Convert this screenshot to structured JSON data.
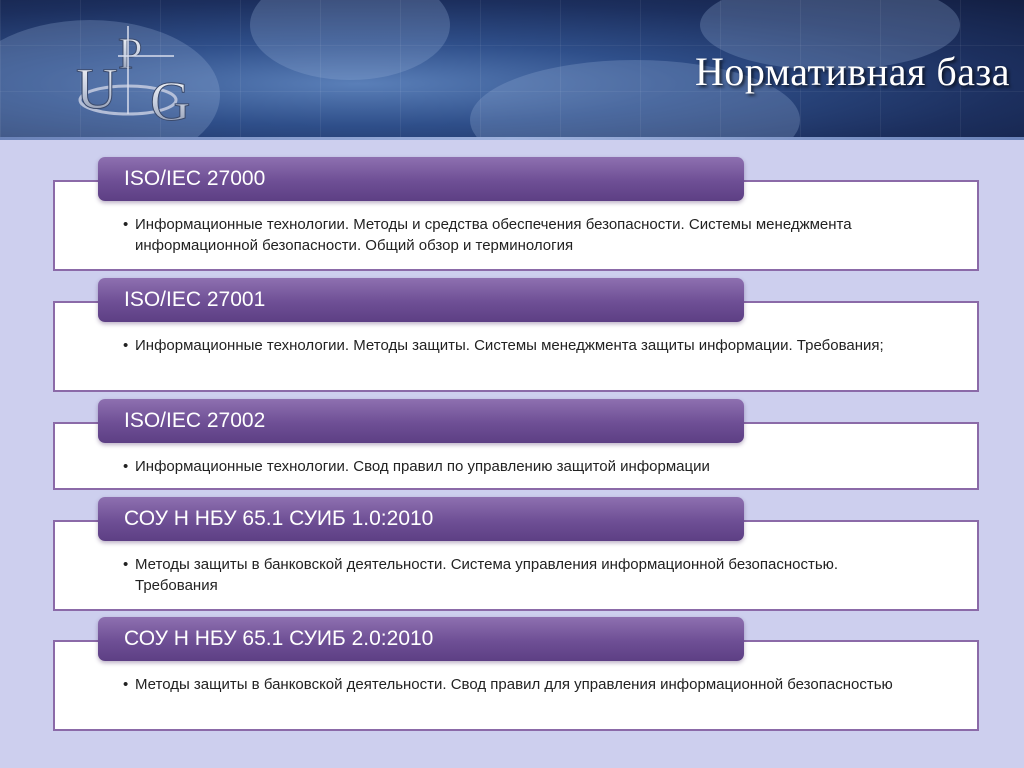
{
  "header": {
    "logo_text": "UPG",
    "title": "Нормативная база"
  },
  "standards": [
    {
      "label": "ISO/IEC 27000",
      "description": "Информационные технологии. Методы и средства обеспечения безопасности. Системы менеджмента информационной безопасности. Общий обзор и терминология"
    },
    {
      "label": "ISO/IEC 27001",
      "description": "Информационные технологии. Методы защиты. Системы менеджмента защиты информации. Требования;"
    },
    {
      "label": "ISO/IEC 27002",
      "description": "Информационные технологии. Свод правил по управлению защитой информации"
    },
    {
      "label": "СОУ Н НБУ 65.1 СУИБ 1.0:2010",
      "description": "Методы защиты в банковской деятельности. Система управления информационной безопасностью. Требования"
    },
    {
      "label": "СОУ Н НБУ 65.1 СУИБ 2.0:2010",
      "description": "Методы защиты в банковской деятельности. Свод правил для управления информационной безопасностью"
    }
  ],
  "colors": {
    "label_fill": "#6e4f95",
    "box_border": "#8b6aa8",
    "page_background": "#cdcfee"
  }
}
